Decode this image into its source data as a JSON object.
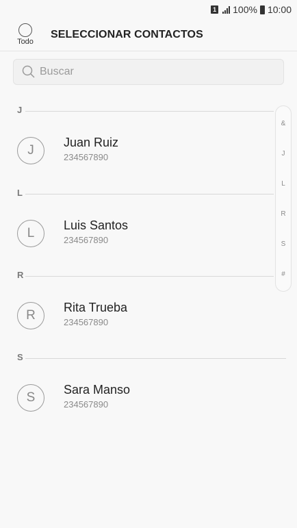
{
  "status_bar": {
    "sim_label": "1",
    "battery_percent": "100%",
    "time": "10:00"
  },
  "header": {
    "select_all_label": "Todo",
    "title": "SELECCIONAR CONTACTOS"
  },
  "search": {
    "placeholder": "Buscar"
  },
  "sections": [
    {
      "letter": "J",
      "contacts": [
        {
          "initial": "J",
          "name": "Juan Ruiz",
          "number": "234567890"
        }
      ]
    },
    {
      "letter": "L",
      "contacts": [
        {
          "initial": "L",
          "name": "Luis Santos",
          "number": "234567890"
        }
      ]
    },
    {
      "letter": "R",
      "contacts": [
        {
          "initial": "R",
          "name": "Rita Trueba",
          "number": "234567890"
        }
      ]
    },
    {
      "letter": "S",
      "contacts": [
        {
          "initial": "S",
          "name": "Sara Manso",
          "number": "234567890"
        }
      ]
    }
  ],
  "index_bar": [
    "&",
    "J",
    "L",
    "R",
    "S",
    "#"
  ],
  "colors": {
    "background": "#f8f8f8",
    "text_primary": "#222222",
    "text_secondary": "#8a8a8a"
  }
}
